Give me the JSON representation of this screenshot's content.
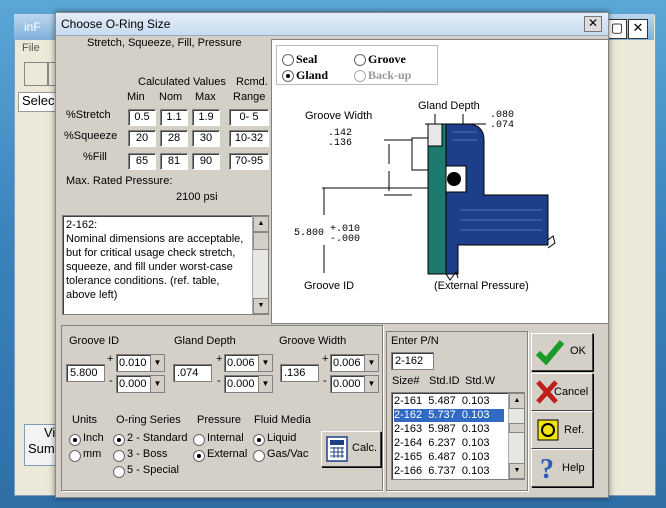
{
  "background_app": {
    "title": "inF",
    "menu_file": "File",
    "field_text": "Selec",
    "side_labels": [
      "Vi",
      "Sum"
    ]
  },
  "dialog": {
    "title": "Choose O-Ring Size",
    "close_glyph": "✕",
    "subtitle": "Stretch, Squeeze, Fill, Pressure"
  },
  "values_table": {
    "header_calc": "Calculated Values",
    "header_rcmd": "Rcmd.",
    "col_min": "Min",
    "col_nom": "Nom",
    "col_max": "Max",
    "col_range": "Range",
    "rows": [
      {
        "label": "%Stretch",
        "min": "0.5",
        "nom": "1.1",
        "max": "1.9",
        "range": "0- 5"
      },
      {
        "label": "%Squeeze",
        "min": "20",
        "nom": "28",
        "max": "30",
        "range": "10-32"
      },
      {
        "label": "%Fill",
        "min": "65",
        "nom": "81",
        "max": "90",
        "range": "70-95"
      }
    ],
    "pressure_label": "Max. Rated Pressure:",
    "pressure_value": "2100 psi"
  },
  "note": {
    "lines": [
      "2-162:",
      "  Nominal dimensions are acceptable,",
      "but for critical usage check stretch,",
      "squeeze, and fill under worst-case",
      "tolerance conditions.  (ref. table,",
      "above left)"
    ]
  },
  "diagram": {
    "opt_seal": "Seal",
    "opt_groove": "Groove",
    "opt_gland": "Gland",
    "opt_backup": "Back-up",
    "gland_depth_label": "Gland Depth",
    "gland_depth_hi": ".080",
    "gland_depth_lo": ".074",
    "groove_width_label": "Groove Width",
    "groove_width_hi": ".142",
    "groove_width_lo": ".136",
    "groove_id_value": "5.800",
    "groove_id_tol_plus": "+.010",
    "groove_id_tol_minus": "-.000",
    "groove_id_label": "Groove ID",
    "pressure_label": "(External Pressure)"
  },
  "dims": {
    "groove_id_label": "Groove ID",
    "groove_id_value": "5.800",
    "groove_id_plus": "0.010",
    "groove_id_minus": "0.000",
    "gland_depth_label": "Gland Depth",
    "gland_depth_value": ".074",
    "gland_depth_plus": "0.006",
    "gland_depth_minus": "0.000",
    "groove_width_label": "Groove Width",
    "groove_width_value": ".136",
    "groove_width_plus": "0.006",
    "groove_width_minus": "0.000",
    "plus_sign": "+",
    "minus_sign": "-"
  },
  "options": {
    "units_label": "Units",
    "units": [
      "Inch",
      "mm"
    ],
    "series_label": "O-ring Series",
    "series": [
      "2 - Standard",
      "3 - Boss",
      "5 - Special"
    ],
    "pressure_label": "Pressure",
    "pressure": [
      "Internal",
      "External"
    ],
    "media_label": "Fluid Media",
    "media": [
      "Liquid",
      "Gas/Vac"
    ],
    "calc_label": "Calc."
  },
  "pn": {
    "enter_label": "Enter P/N",
    "value": "2-162",
    "col_size": "Size#",
    "col_id": "Std.ID",
    "col_w": "Std.W",
    "rows": [
      {
        "size": "2-161",
        "id": "5.487",
        "w": "0.103"
      },
      {
        "size": "2-162",
        "id": "5.737",
        "w": "0.103"
      },
      {
        "size": "2-163",
        "id": "5.987",
        "w": "0.103"
      },
      {
        "size": "2-164",
        "id": "6.237",
        "w": "0.103"
      },
      {
        "size": "2-165",
        "id": "6.487",
        "w": "0.103"
      },
      {
        "size": "2-166",
        "id": "6.737",
        "w": "0.103"
      }
    ]
  },
  "buttons": {
    "ok": "OK",
    "cancel": "Cancel",
    "ref": "Ref.",
    "help": "Help"
  },
  "colors": {
    "selection": "#316ac5",
    "gland_teal": "#1e7a6e",
    "seal_blue": "#1d3f8a",
    "ok_green": "#1a9a2a",
    "cancel_red": "#c0201a"
  }
}
